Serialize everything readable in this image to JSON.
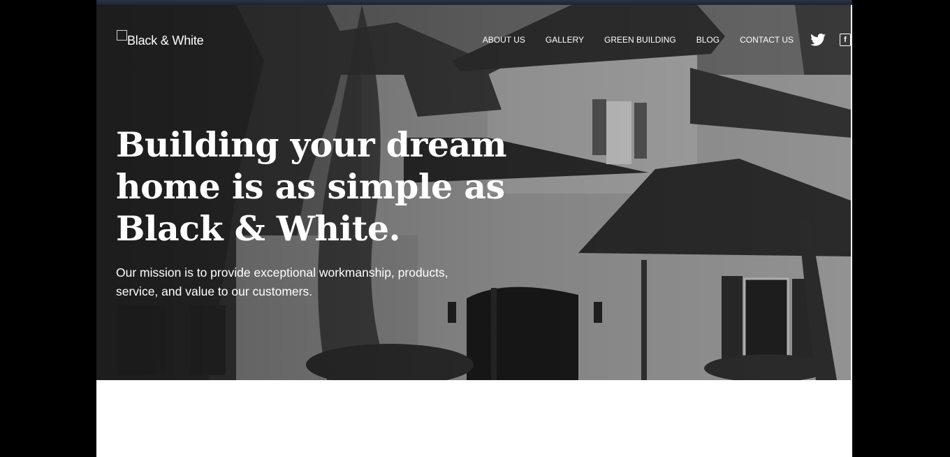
{
  "brand": {
    "name": "Black & White"
  },
  "nav": {
    "items": [
      {
        "label": "ABOUT US"
      },
      {
        "label": "GALLERY"
      },
      {
        "label": "GREEN BUILDING"
      },
      {
        "label": "BLOG"
      },
      {
        "label": "CONTACT US"
      }
    ],
    "social": [
      {
        "icon": "twitter-icon"
      },
      {
        "icon": "facebook-icon",
        "glyph": "f"
      }
    ]
  },
  "hero": {
    "headline": "Building your dream home is as simple as Black & White.",
    "mission": "Our mission is to provide exceptional workmanship, products, service, and value to our customers."
  },
  "colors": {
    "page_background": "#000000",
    "top_strip": "#1c2431",
    "text": "#ffffff",
    "content_background": "#ffffff"
  }
}
